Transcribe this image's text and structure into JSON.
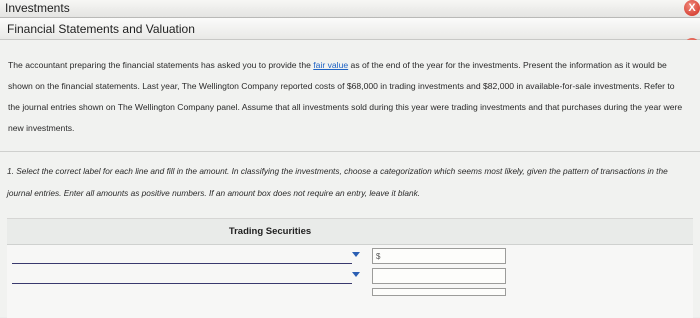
{
  "window": {
    "title": "Investments",
    "subtitle": "Financial Statements and Valuation",
    "close_glyph": "X"
  },
  "intro": {
    "part1": "The accountant preparing the financial statements has asked you to provide the ",
    "link": "fair value",
    "part2": " as of the end of the year for the investments. Present the information as it would be shown on the financial statements. Last year, The Wellington Company reported costs of $68,000 in trading investments and $82,000 in available-for-sale investments. Refer to the journal entries shown on The Wellington Company panel. Assume that all investments sold during this year were trading investments and that purchases during the year were new investments."
  },
  "question": {
    "text": "1. Select the correct label for each line and fill in the amount. In classifying the investments, choose a categorization which seems most likely, given the pattern of transactions in the journal entries. Enter all amounts as positive numbers. If an amount box does not require an entry, leave it blank."
  },
  "table": {
    "heading": "Trading Securities",
    "rows": [
      {
        "label": "",
        "amount": "",
        "currency": "$"
      },
      {
        "label": "",
        "amount": ""
      },
      {
        "label": "",
        "amount": ""
      }
    ]
  },
  "icons": {
    "close": "close-icon",
    "dropdown": "chevron-down-icon"
  },
  "colors": {
    "link": "#1e63c4",
    "close_button": "#d9473a",
    "dropdown_arrow": "#2b5fb3"
  }
}
